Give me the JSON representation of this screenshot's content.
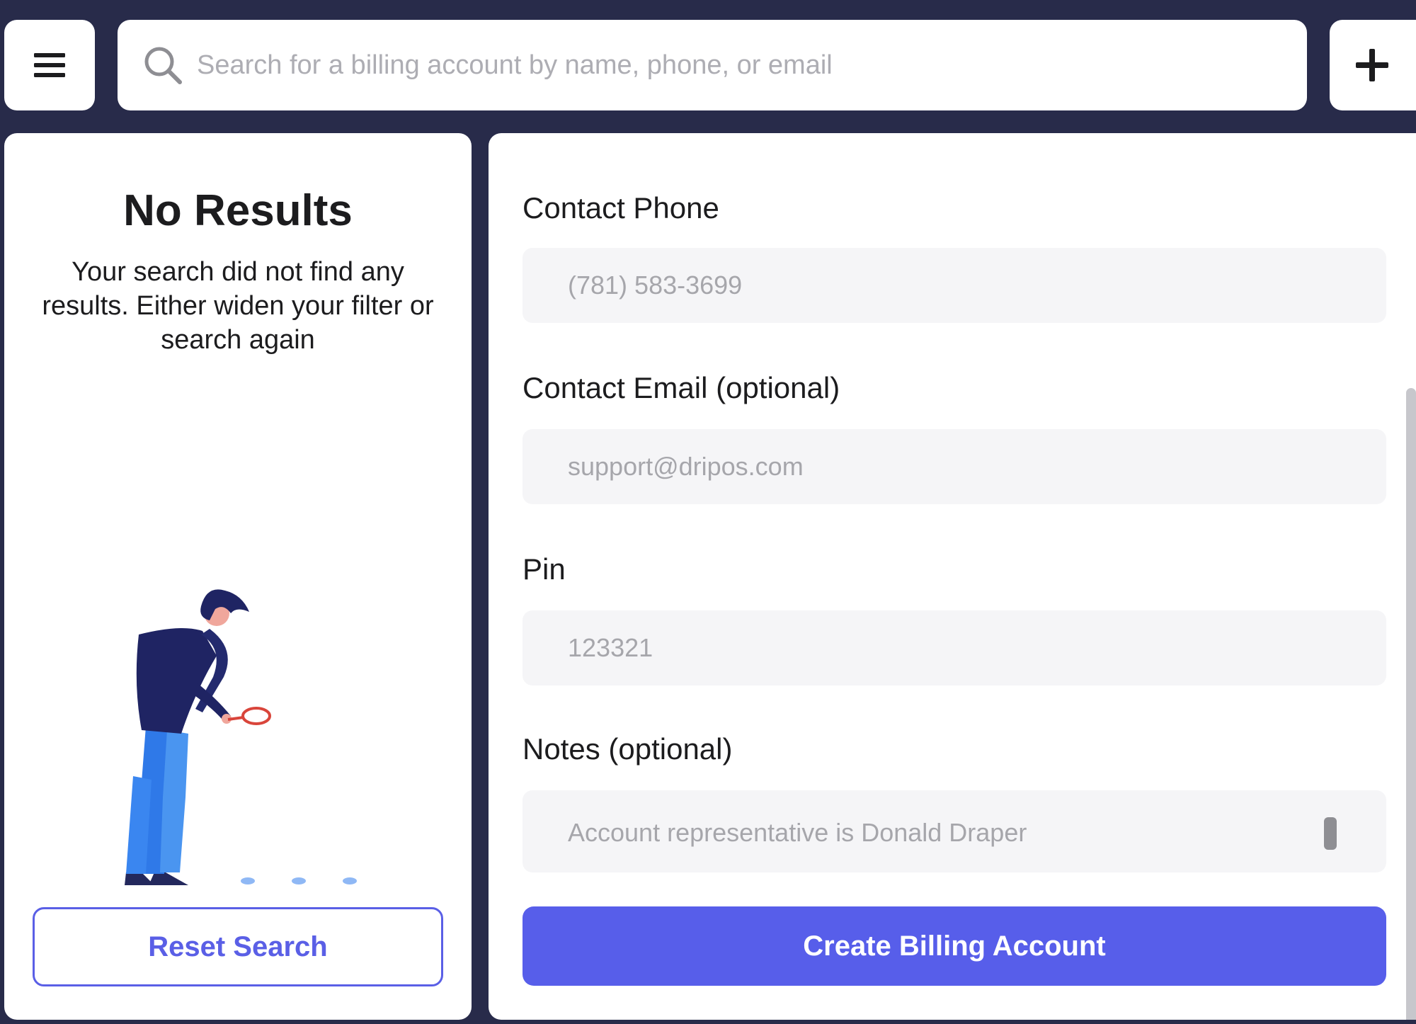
{
  "topbar": {
    "menu_icon": "hamburger-menu-icon",
    "search": {
      "icon": "search-icon",
      "placeholder": "Search for a billing account by name, phone, or email",
      "value": ""
    },
    "add_icon": "plus-icon"
  },
  "results_panel": {
    "title": "No Results",
    "message": "Your search did not find any results. Either widen your filter or search again",
    "illustration": "person-searching-with-magnifying-glass",
    "reset_button_label": "Reset Search"
  },
  "form": {
    "contact_phone": {
      "label": "Contact Phone",
      "placeholder": "(781) 583-3699"
    },
    "contact_email": {
      "label": "Contact Email (optional)",
      "placeholder": "support@dripos.com"
    },
    "pin": {
      "label": "Pin",
      "placeholder": "123321"
    },
    "notes": {
      "label": "Notes (optional)",
      "placeholder": "Account representative is Donald Draper"
    },
    "submit_label": "Create Billing Account"
  },
  "colors": {
    "background": "#282b4a",
    "accent": "#575eea",
    "field_background": "#f5f5f7",
    "placeholder": "#a6a6ab"
  }
}
